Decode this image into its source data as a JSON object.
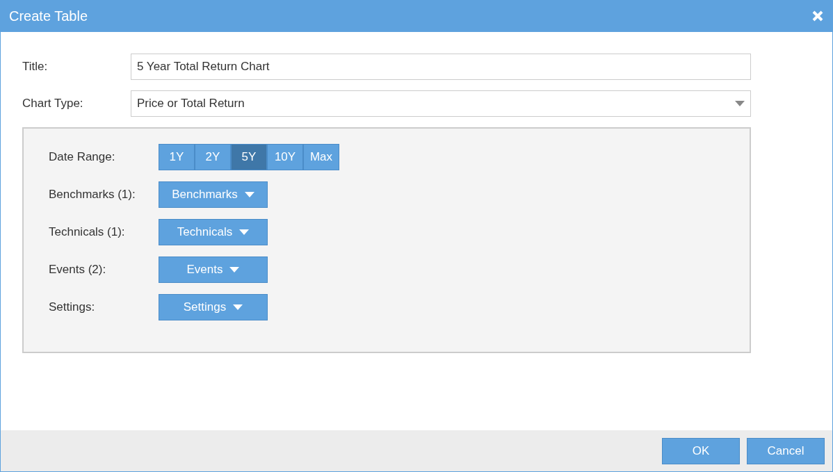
{
  "window": {
    "title": "Create Table"
  },
  "fields": [
    {
      "label": "Title:",
      "kind": "text",
      "value": "5 Year Total Return Chart"
    },
    {
      "label": "Chart Type:",
      "kind": "select",
      "value": "Price or Total Return"
    }
  ],
  "date_range": {
    "label": "Date Range:",
    "options": [
      {
        "label": "1Y",
        "selected": false
      },
      {
        "label": "2Y",
        "selected": false
      },
      {
        "label": "5Y",
        "selected": true
      },
      {
        "label": "10Y",
        "selected": false
      },
      {
        "label": "Max",
        "selected": false
      }
    ]
  },
  "dropdowns": [
    {
      "label": "Benchmarks (1):",
      "button": "Benchmarks"
    },
    {
      "label": "Technicals (1):",
      "button": "Technicals"
    },
    {
      "label": "Events (2):",
      "button": "Events"
    },
    {
      "label": "Settings:",
      "button": "Settings"
    }
  ],
  "buttons": [
    "OK",
    "Cancel"
  ]
}
